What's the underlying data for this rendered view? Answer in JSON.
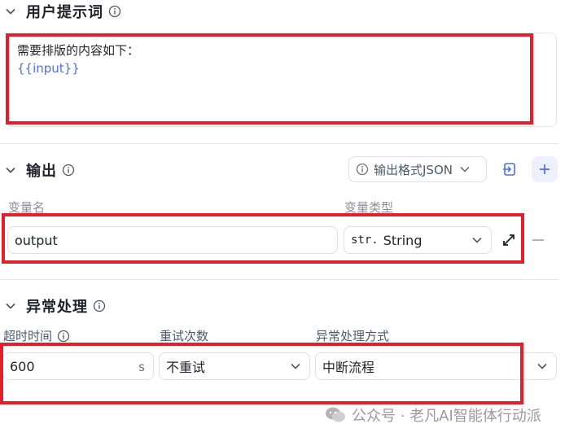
{
  "prompt_section": {
    "title": "用户提示词",
    "line1": "需要排版的内容如下：",
    "variable": "{{input}}"
  },
  "output_section": {
    "title": "输出",
    "format_button_label": "输出格式JSON",
    "col_name": "变量名",
    "col_type": "变量类型",
    "var_name": "output",
    "type_prefix": "str.",
    "type_value": "String"
  },
  "error_section": {
    "title": "异常处理",
    "col_timeout": "超时时间",
    "col_retry": "重试次数",
    "col_method": "异常处理方式",
    "timeout_value": "600",
    "timeout_unit": "s",
    "retry_value": "不重试",
    "method_value": "中断流程"
  },
  "watermark": {
    "text": "公众号 · 老凡AI智能体行动派"
  },
  "colors": {
    "accent": "#4e6ef2",
    "highlight_box": "#e0202a",
    "add_button_bg": "#eef0fe"
  }
}
